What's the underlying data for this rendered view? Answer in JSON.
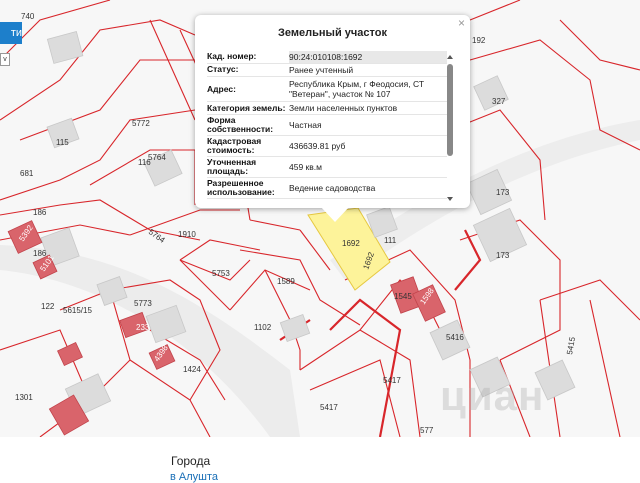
{
  "map": {
    "parcel_labels": [
      {
        "text": "740"
      },
      {
        "text": "192"
      },
      {
        "text": "327"
      },
      {
        "text": "115"
      },
      {
        "text": "5772"
      },
      {
        "text": "5764"
      },
      {
        "text": "116"
      },
      {
        "text": "681"
      },
      {
        "text": "186"
      },
      {
        "text": "186"
      },
      {
        "text": "5764"
      },
      {
        "text": "1910"
      },
      {
        "text": "173"
      },
      {
        "text": "173"
      },
      {
        "text": "1692"
      },
      {
        "text": "1692"
      },
      {
        "text": "111"
      },
      {
        "text": "122"
      },
      {
        "text": "5615/15"
      },
      {
        "text": "5773"
      },
      {
        "text": "5753"
      },
      {
        "text": "1589"
      },
      {
        "text": "1545"
      },
      {
        "text": "5416"
      },
      {
        "text": "1102"
      },
      {
        "text": "1424"
      },
      {
        "text": "1301"
      },
      {
        "text": "5417"
      },
      {
        "text": "5417"
      },
      {
        "text": "577"
      },
      {
        "text": "5415"
      },
      {
        "text": "233"
      },
      {
        "text": "5392"
      },
      {
        "text": "5101"
      },
      {
        "text": "1598"
      },
      {
        "text": "4398"
      }
    ],
    "highlight_color": "#fdf39a",
    "boundary_color": "#d8262b",
    "building_color": "#dcdcdc",
    "hatched_color": "#d9646b"
  },
  "controls": {
    "find_button_label": "ти",
    "select_value": "v"
  },
  "popup": {
    "title": "Земельный участок",
    "close_icon": "×",
    "rows": [
      {
        "label": "Кад. номер:",
        "value": "90:24:010108:1692"
      },
      {
        "label": "Статус:",
        "value": "Ранее учтенный"
      },
      {
        "label": "Адрес:",
        "value": "Республика Крым, г Феодосия, СТ \"Ветеран\", участок № 107"
      },
      {
        "label": "Категория земель:",
        "value": "Земли населенных пунктов"
      },
      {
        "label": "Форма собственности:",
        "value": "Частная"
      },
      {
        "label": "Кадастровая стоимость:",
        "value": "436639.81 руб"
      },
      {
        "label": "Уточненная площадь:",
        "value": "459 кв.м"
      },
      {
        "label": "Разрешенное использование:",
        "value": "Ведение садоводства"
      }
    ]
  },
  "footer": {
    "title": "Города",
    "link": "в Алушта"
  },
  "watermark": "циан"
}
